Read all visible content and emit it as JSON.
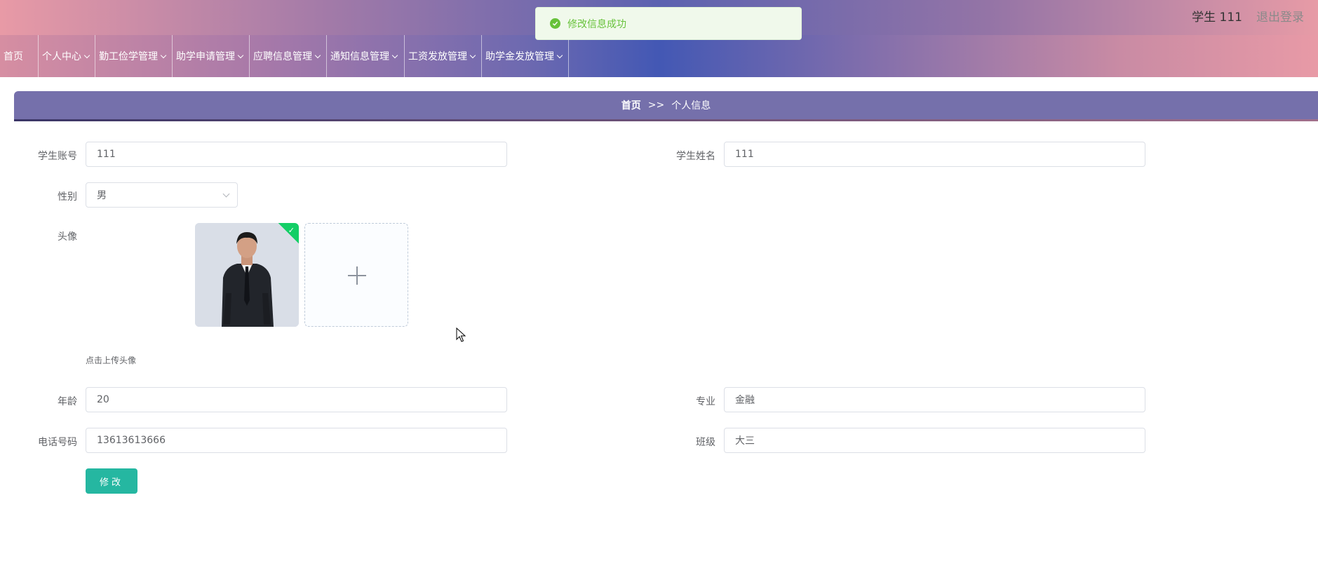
{
  "header": {
    "user_label": "学生 111",
    "logout_label": "退出登录"
  },
  "toast": {
    "message": "修改信息成功",
    "icon": "success-check-icon",
    "color": "#67c23a"
  },
  "nav": {
    "home": "首页",
    "items": [
      {
        "label": "个人中心"
      },
      {
        "label": "勤工俭学管理"
      },
      {
        "label": "助学申请管理"
      },
      {
        "label": "应聘信息管理"
      },
      {
        "label": "通知信息管理"
      },
      {
        "label": "工资发放管理"
      },
      {
        "label": "助学金发放管理"
      }
    ]
  },
  "breadcrumb": {
    "home": "首页",
    "separator": ">>",
    "current": "个人信息"
  },
  "form": {
    "account_label": "学生账号",
    "account_value": "111",
    "name_label": "学生姓名",
    "name_value": "111",
    "gender_label": "性别",
    "gender_value": "男",
    "avatar_label": "头像",
    "avatar_tip": "点击上传头像",
    "age_label": "年龄",
    "age_value": "20",
    "major_label": "专业",
    "major_value": "金融",
    "phone_label": "电话号码",
    "phone_value": "13613613666",
    "class_label": "班级",
    "class_value": "大三",
    "submit_label": "修改"
  },
  "colors": {
    "accent_button": "#25b7a1",
    "breadcrumb_bg": "#7570ab",
    "success": "#67c23a"
  }
}
